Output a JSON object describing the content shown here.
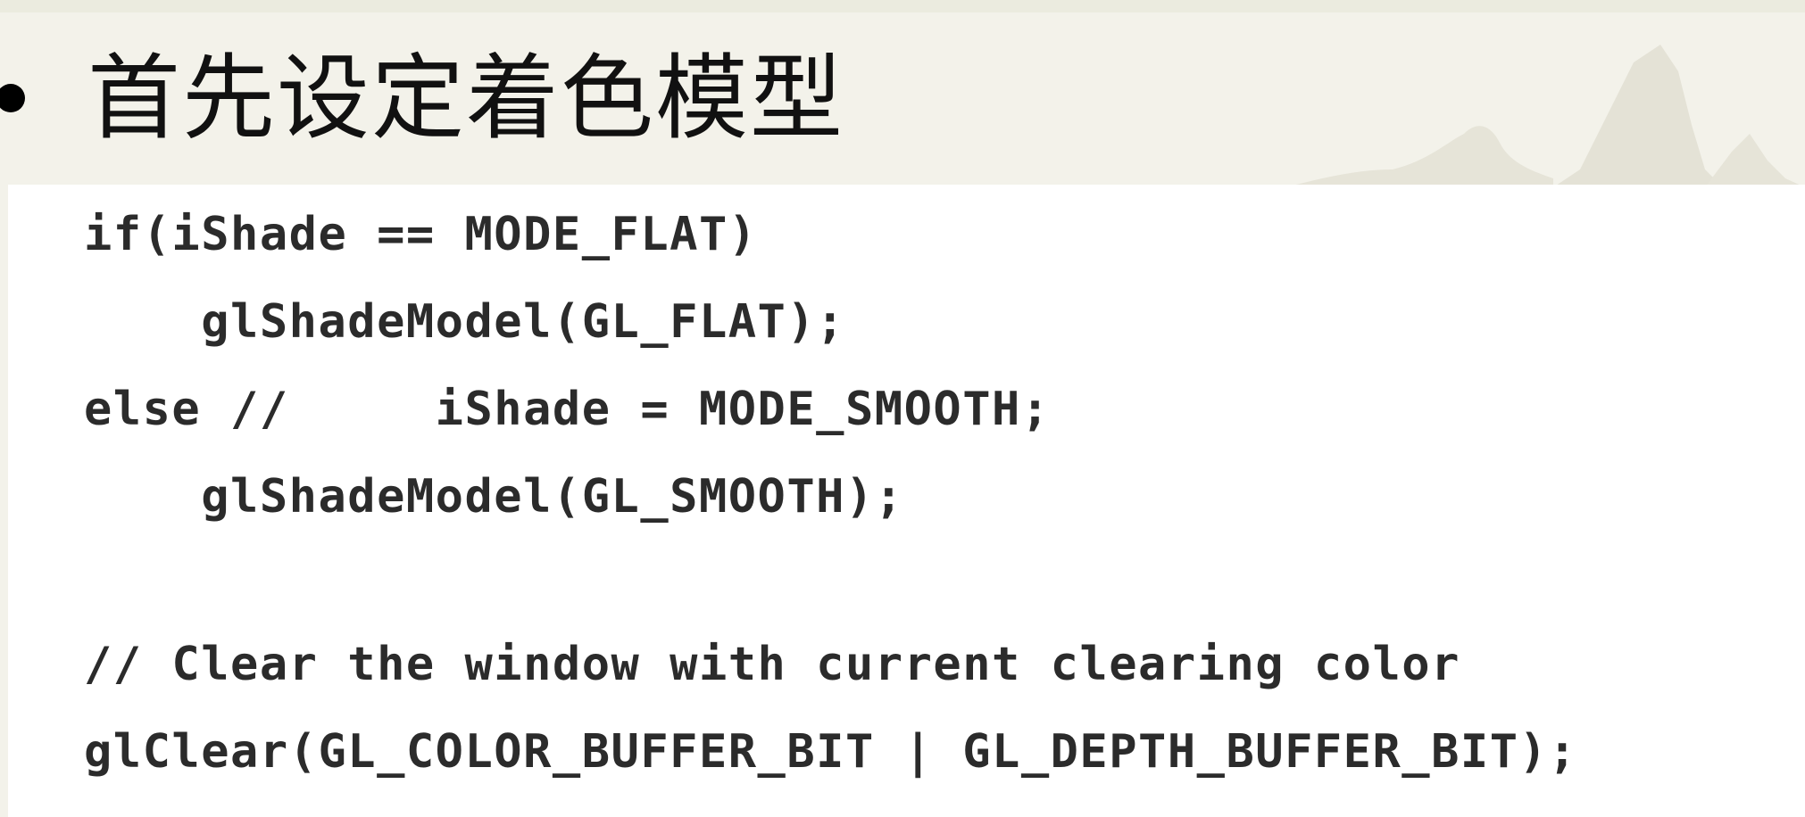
{
  "slide": {
    "heading": "首先设定着色模型"
  },
  "code": {
    "lines": [
      "if(iShade == MODE_FLAT)",
      "    glShadeModel(GL_FLAT);",
      "else //     iShade = MODE_SMOOTH;",
      "    glShadeModel(GL_SMOOTH);",
      "// Clear the window with current clearing color",
      "glClear(GL_COLOR_BUFFER_BIT | GL_DEPTH_BUFFER_BIT);"
    ]
  },
  "colors": {
    "background": "#f3f2ea",
    "code_background": "#ffffff",
    "text": "#2b2b2b",
    "watermark": "#e4e2d6"
  }
}
